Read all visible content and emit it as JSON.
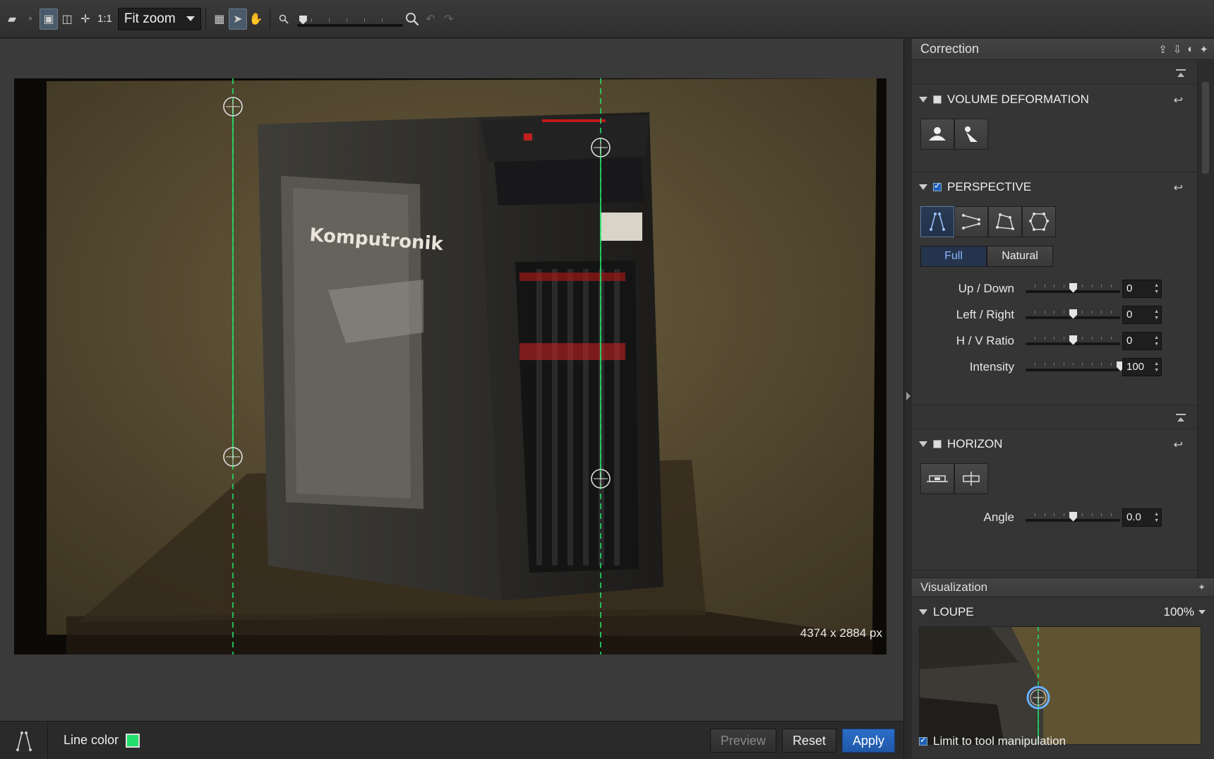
{
  "toolbar": {
    "one_to_one": "1:1",
    "zoom_mode": "Fit zoom"
  },
  "canvas": {
    "dimensions": "4374 x 2884 px",
    "brand_text": "Komputronik"
  },
  "bottom": {
    "line_color_label": "Line color",
    "line_color": "#22e06a",
    "preview_label": "Preview",
    "reset_label": "Reset",
    "apply_label": "Apply"
  },
  "panel": {
    "title": "Correction",
    "volume": {
      "title": "VOLUME DEFORMATION",
      "enabled": false
    },
    "perspective": {
      "title": "PERSPECTIVE",
      "enabled": true,
      "modes": [
        "Full",
        "Natural"
      ],
      "active_mode": "Full",
      "sliders": [
        {
          "label": "Up / Down",
          "value": "0",
          "position": 0.5
        },
        {
          "label": "Left / Right",
          "value": "0",
          "position": 0.5
        },
        {
          "label": "H / V Ratio",
          "value": "0",
          "position": 0.5
        },
        {
          "label": "Intensity",
          "value": "100",
          "position": 1.0
        }
      ]
    },
    "horizon": {
      "title": "HORIZON",
      "enabled": false,
      "angle_label": "Angle",
      "angle_value": "0.0"
    }
  },
  "visualization": {
    "title": "Visualization",
    "loupe_title": "LOUPE",
    "loupe_zoom": "100%",
    "limit_label": "Limit to tool manipulation",
    "limit_checked": true
  },
  "colors": {
    "accent": "#1f58a8",
    "guide_line": "#22e06a"
  }
}
